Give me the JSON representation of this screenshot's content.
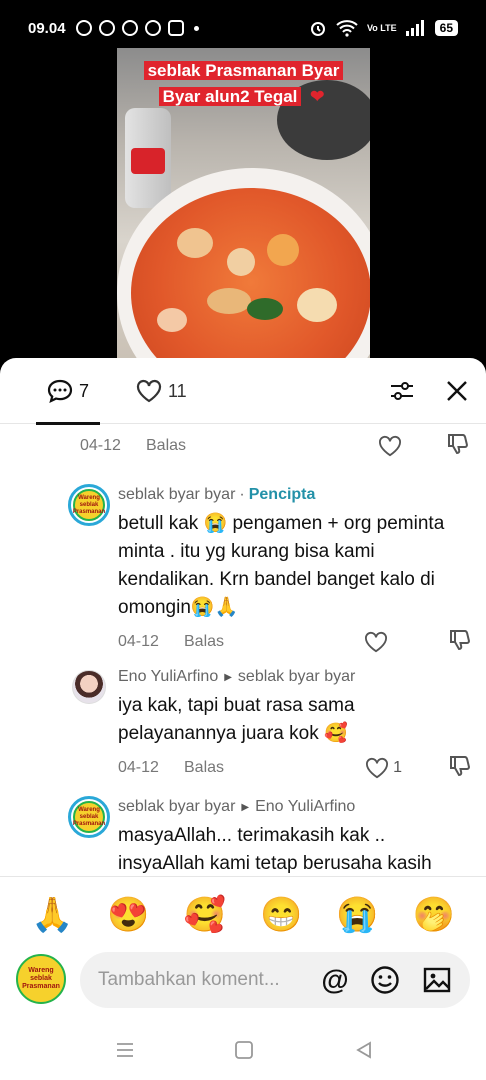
{
  "status_bar": {
    "time": "09.04",
    "battery": "65",
    "network": "Vo LTE"
  },
  "video": {
    "caption_line1": "seblak Prasmanan Byar",
    "caption_line2": "Byar alun2 Tegal"
  },
  "header": {
    "comment_count": "7",
    "like_count": "11",
    "icons": [
      "comment-icon",
      "heart-icon",
      "filter-icon",
      "close-icon"
    ]
  },
  "top_row": {
    "date": "04-12",
    "reply_label": "Balas"
  },
  "comments": [
    {
      "author": "seblak byar byar",
      "separator": "·",
      "badge": "Pencipta",
      "text": "betull kak 😭 pengamen + org peminta minta . itu yg kurang bisa kami kendalikan. Krn bandel banget kalo di omongin😭🙏",
      "date": "04-12",
      "reply_label": "Balas",
      "likes": ""
    },
    {
      "author": "Eno YuliArfino",
      "reply_to": "seblak byar byar",
      "text": "iya kak, tapi buat rasa sama pelayanannya juara kok 🥰",
      "date": "04-12",
      "reply_label": "Balas",
      "likes": "1"
    },
    {
      "author": "seblak byar byar",
      "reply_to": "Eno YuliArfino",
      "text": "masyaAllah... terimakasih kak .. insyaAllah kami tetap berusaha kasih"
    }
  ],
  "avatar_text": "Wareng seblak Prasmanan",
  "emoji_bar": [
    "🙏",
    "😍",
    "🥰",
    "😁",
    "😭",
    "🤭"
  ],
  "input": {
    "placeholder": "Tambahkan koment..."
  },
  "colors": {
    "creator": "#2391a8",
    "caption_bg": "#e0242d"
  }
}
